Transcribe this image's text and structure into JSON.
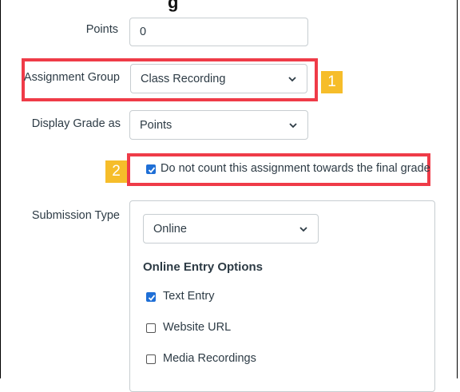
{
  "top_heading": "g",
  "points": {
    "label": "Points",
    "value": "0"
  },
  "assignment_group": {
    "label": "Assignment Group",
    "value": "Class Recording",
    "badge": "1"
  },
  "display_grade": {
    "label": "Display Grade as",
    "value": "Points"
  },
  "do_not_count": {
    "label": "Do not count this assignment towards the final grade",
    "checked": true,
    "badge": "2"
  },
  "submission": {
    "label": "Submission Type",
    "type_value": "Online",
    "section_title": "Online Entry Options",
    "options": [
      {
        "label": "Text Entry",
        "checked": true
      },
      {
        "label": "Website URL",
        "checked": false
      },
      {
        "label": "Media Recordings",
        "checked": false
      }
    ]
  },
  "colors": {
    "highlight": "#ef3b48",
    "badge": "#f6bd2a",
    "checkbox": "#1f6fd6"
  }
}
